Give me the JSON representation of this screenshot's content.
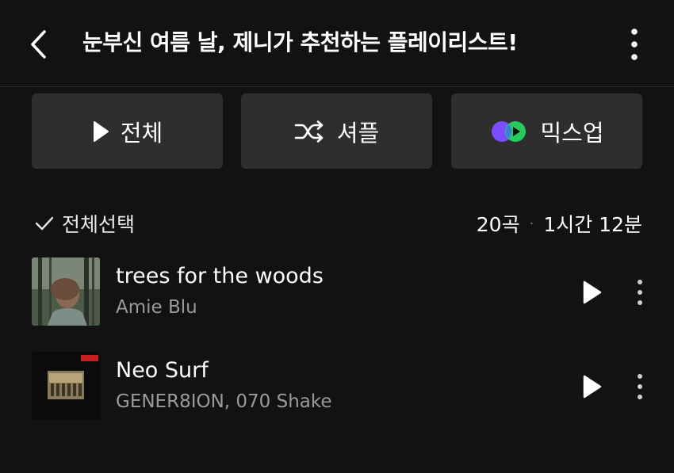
{
  "header": {
    "back_icon": "chevron-left-icon",
    "title": "눈부신 여름 날, 제니가 추천하는 플레이리스트!",
    "more_icon": "more-vertical-icon"
  },
  "actions": {
    "play_all": {
      "label": "전체",
      "icon": "play-icon"
    },
    "shuffle": {
      "label": "셔플",
      "icon": "shuffle-icon"
    },
    "mixup": {
      "label": "믹스업",
      "icon": "mixup-icon"
    }
  },
  "list_header": {
    "select_all_label": "전체선택",
    "track_count": "20곡",
    "separator": "·",
    "duration": "1시간 12분"
  },
  "tracks": [
    {
      "title": "trees for the woods",
      "artist": "Amie Blu"
    },
    {
      "title": "Neo Surf",
      "artist": "GENER8ION, 070 Shake"
    }
  ],
  "colors": {
    "background": "#121212",
    "button_bg": "#2e2e2e",
    "secondary_text": "#9a9a9a",
    "mix_purple": "#7b4dff",
    "mix_green": "#27d35f"
  }
}
